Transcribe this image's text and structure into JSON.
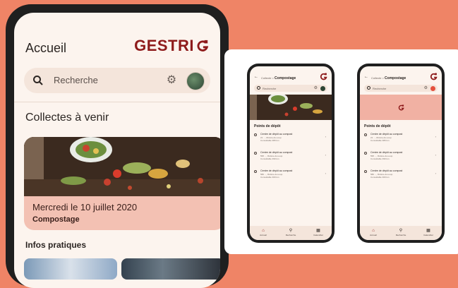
{
  "main_phone": {
    "title": "Accueil",
    "brand_text": "GESTRI",
    "search": {
      "placeholder": "Recherche",
      "icons": [
        "search-icon",
        "gear-icon",
        "avatar"
      ]
    },
    "upcoming_title": "Collectes à venir",
    "collection": {
      "date": "Mercredi le 10 juillet 2020",
      "type": "Compostage"
    },
    "infos_title": "Infos pratiques"
  },
  "small_phones": [
    {
      "crumb_parent": "Collecte >",
      "crumb_current": "Compostage",
      "search_placeholder": "Recherche",
      "section_title": "Points de dépôt",
      "items": [
        {
          "title": "Centre de dépôt au compost",
          "address": "21 ..., Rivière-du-Loup",
          "distance": "Consultable 380 km"
        },
        {
          "title": "Centre de dépôt au compost",
          "address": "595 ..., Rivière-du-Loup",
          "distance": "Consultable 390 km"
        },
        {
          "title": "Centre de dépôt au compost",
          "address": "580 ..., Rivière-du-Loup",
          "distance": "Consultable 300 km"
        }
      ],
      "nav": [
        "Accueil",
        "Recherche",
        "Calendrier"
      ]
    },
    {
      "crumb_parent": "Collecte >",
      "crumb_current": "Compostage",
      "search_placeholder": "Recherche",
      "section_title": "Points de dépôt",
      "items": [
        {
          "title": "Centre de dépôt au compost",
          "address": "21 ..., Rivière-du-Loup",
          "distance": "Consultable 380 km"
        },
        {
          "title": "Centre de dépôt au compost",
          "address": "595 ..., Rivière-du-Loup",
          "distance": "Consultable 390 km"
        },
        {
          "title": "Centre de dépôt au compost",
          "address": "580 ..., Rivière-du-Loup",
          "distance": "Consultable 300 km"
        }
      ],
      "nav": [
        "Accueil",
        "Recherche",
        "Calendrier"
      ]
    }
  ],
  "colors": {
    "background": "#ef8466",
    "brand": "#8e1b1b",
    "card_pink": "#f3c1b3",
    "screen_bg": "#fcf4ee"
  }
}
